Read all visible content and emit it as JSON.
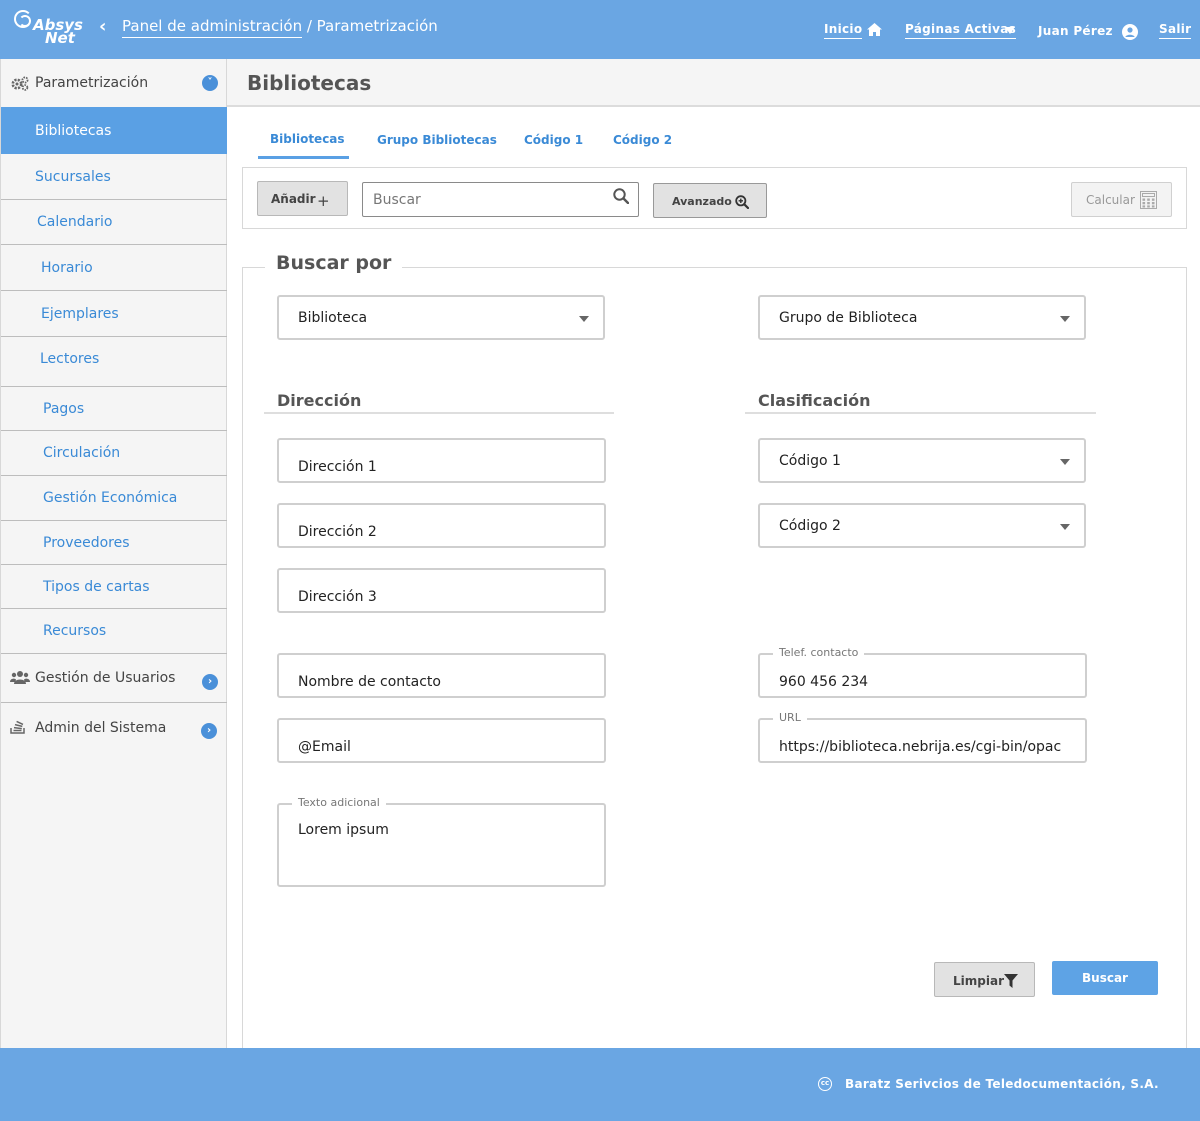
{
  "header": {
    "logo_line1": "Absys",
    "logo_line2": "Net",
    "breadcrumb_link": "Panel de administración",
    "breadcrumb_sep": " / ",
    "breadcrumb_current": "Parametrización",
    "home_label": "Inicio",
    "active_pages_label": "Páginas Activas",
    "user_name": "Juan Pérez",
    "logout_label": "Salir"
  },
  "sidebar": {
    "section_param": "Parametrización",
    "items": [
      "Bibliotecas",
      "Sucursales",
      "Calendario",
      "Horario",
      "Ejemplares",
      "Lectores",
      "Pagos",
      "Circulación",
      "Gestión Económica",
      "Proveedores",
      "Tipos de cartas",
      "Recursos"
    ],
    "section_users": "Gestión de Usuarios",
    "section_admin": "Admin del Sistema"
  },
  "page": {
    "title": "Bibliotecas"
  },
  "tabs": [
    "Bibliotecas",
    "Grupo Bibliotecas",
    "Código 1",
    "Código 2"
  ],
  "toolbar": {
    "add_label": "Añadir",
    "search_placeholder": "Buscar",
    "advanced_label": "Avanzado",
    "calc_label": "Calcular"
  },
  "form": {
    "legend": "Buscar por",
    "biblioteca": "Biblioteca",
    "grupo": "Grupo de Biblioteca",
    "section_direccion": "Dirección",
    "section_clasificacion": "Clasificación",
    "direccion1": "Dirección 1",
    "direccion2": "Dirección 2",
    "direccion3": "Dirección 3",
    "codigo1": "Código 1",
    "codigo2": "Código 2",
    "contacto": "Nombre de contacto",
    "telef_label": "Telef. contacto",
    "telef_value": "960 456 234",
    "email": "@Email",
    "url_label": "URL",
    "url_value": "https://biblioteca.nebrija.es/cgi-bin/opac",
    "texto_label": "Texto adicional",
    "texto_value": "Lorem ipsum",
    "clear_label": "Limpiar",
    "search_label": "Buscar"
  },
  "footer": {
    "cc_icon": "cc",
    "company": "Baratz Serivcios de Teledocumentación, S.A."
  }
}
